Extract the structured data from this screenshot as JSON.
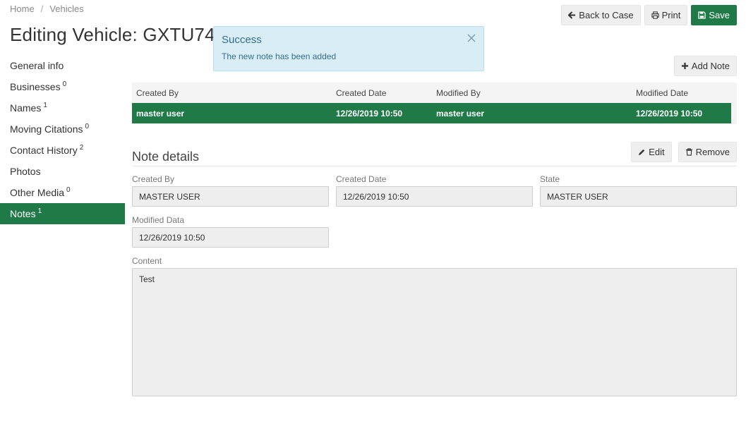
{
  "breadcrumb": {
    "home": "Home",
    "current": "Vehicles"
  },
  "page_title": "Editing Vehicle: GXTU74 F",
  "top_actions": {
    "back": "Back to Case",
    "print": "Print",
    "save": "Save"
  },
  "alert": {
    "title": "Success",
    "message": "The new note has been added"
  },
  "sidebar": {
    "items": [
      {
        "label": "General info",
        "count": ""
      },
      {
        "label": "Businesses",
        "count": "0"
      },
      {
        "label": "Names",
        "count": "1"
      },
      {
        "label": "Moving Citations",
        "count": "0"
      },
      {
        "label": "Contact History",
        "count": "2"
      },
      {
        "label": "Photos",
        "count": ""
      },
      {
        "label": "Other Media",
        "count": "0"
      },
      {
        "label": "Notes",
        "count": "1"
      }
    ],
    "active_index": 7
  },
  "add_note_label": "Add Note",
  "table": {
    "headers": [
      "Created By",
      "Created Date",
      "Modified By",
      "Modified Date"
    ],
    "rows": [
      [
        "master user",
        "12/26/2019 10:50",
        "master user",
        "12/26/2019 10:50"
      ]
    ]
  },
  "details": {
    "title": "Note details",
    "edit_label": "Edit",
    "remove_label": "Remove",
    "created_by": {
      "label": "Created By",
      "value": "MASTER USER"
    },
    "created_date": {
      "label": "Created Date",
      "value": "12/26/2019 10:50"
    },
    "state": {
      "label": "State",
      "value": "MASTER USER"
    },
    "modified_data": {
      "label": "Modified Data",
      "value": "12/26/2019 10:50"
    },
    "content": {
      "label": "Content",
      "value": "Test"
    }
  },
  "colors": {
    "primary": "#1f7a48",
    "alert_bg": "#d9edf7",
    "alert_text": "#31708f"
  },
  "icons": {
    "back": "arrow-left-icon",
    "print": "print-icon",
    "save": "floppy-disk-icon",
    "add": "plus-icon",
    "edit": "pencil-icon",
    "remove": "trash-icon",
    "close": "close-icon"
  }
}
